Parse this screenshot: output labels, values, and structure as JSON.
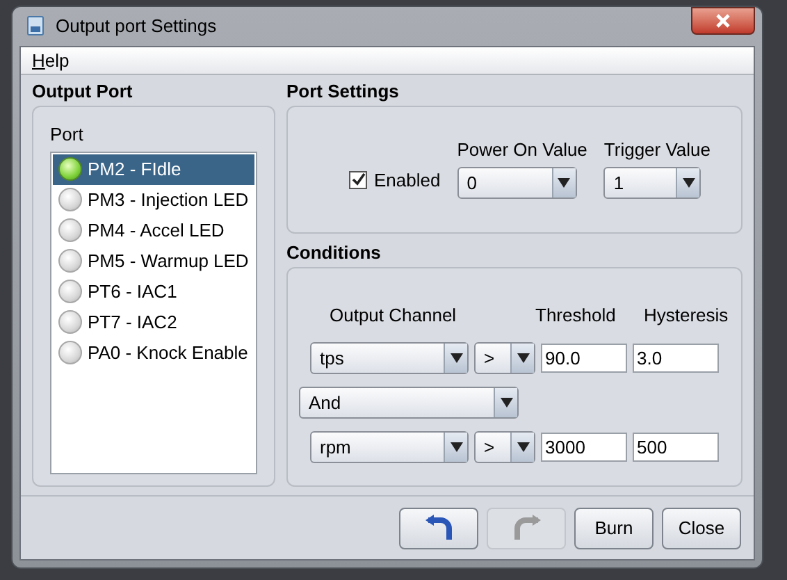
{
  "window": {
    "title": "Output port Settings"
  },
  "menu": [
    "Help"
  ],
  "output_port": {
    "title": "Output Port",
    "list_label": "Port",
    "ports": [
      {
        "label": "PM2 - FIdle",
        "selected": true,
        "on": true
      },
      {
        "label": "PM3 - Injection LED",
        "selected": false,
        "on": false
      },
      {
        "label": "PM4 - Accel LED",
        "selected": false,
        "on": false
      },
      {
        "label": "PM5 - Warmup LED",
        "selected": false,
        "on": false
      },
      {
        "label": "PT6 - IAC1",
        "selected": false,
        "on": false
      },
      {
        "label": "PT7 - IAC2",
        "selected": false,
        "on": false
      },
      {
        "label": "PA0 - Knock Enable",
        "selected": false,
        "on": false
      }
    ]
  },
  "port_settings": {
    "title": "Port Settings",
    "enabled": {
      "label": "Enabled",
      "checked": true
    },
    "power_on": {
      "label": "Power On Value",
      "value": "0"
    },
    "trigger": {
      "label": "Trigger Value",
      "value": "1"
    }
  },
  "conditions": {
    "title": "Conditions",
    "columns": [
      "Output Channel",
      "Threshold",
      "Hysteresis"
    ],
    "rows": [
      {
        "channel": "tps",
        "operator": ">",
        "threshold": "90.0",
        "hysteresis": "3.0"
      },
      {
        "channel": "rpm",
        "operator": ">",
        "threshold": "3000",
        "hysteresis": "500"
      }
    ],
    "join": "And"
  },
  "buttons": [
    {
      "kind": "undo",
      "disabled": false
    },
    {
      "kind": "redo",
      "disabled": true
    },
    {
      "kind": "text",
      "label": "Burn",
      "disabled": false
    },
    {
      "kind": "text",
      "label": "Close",
      "disabled": false
    }
  ]
}
